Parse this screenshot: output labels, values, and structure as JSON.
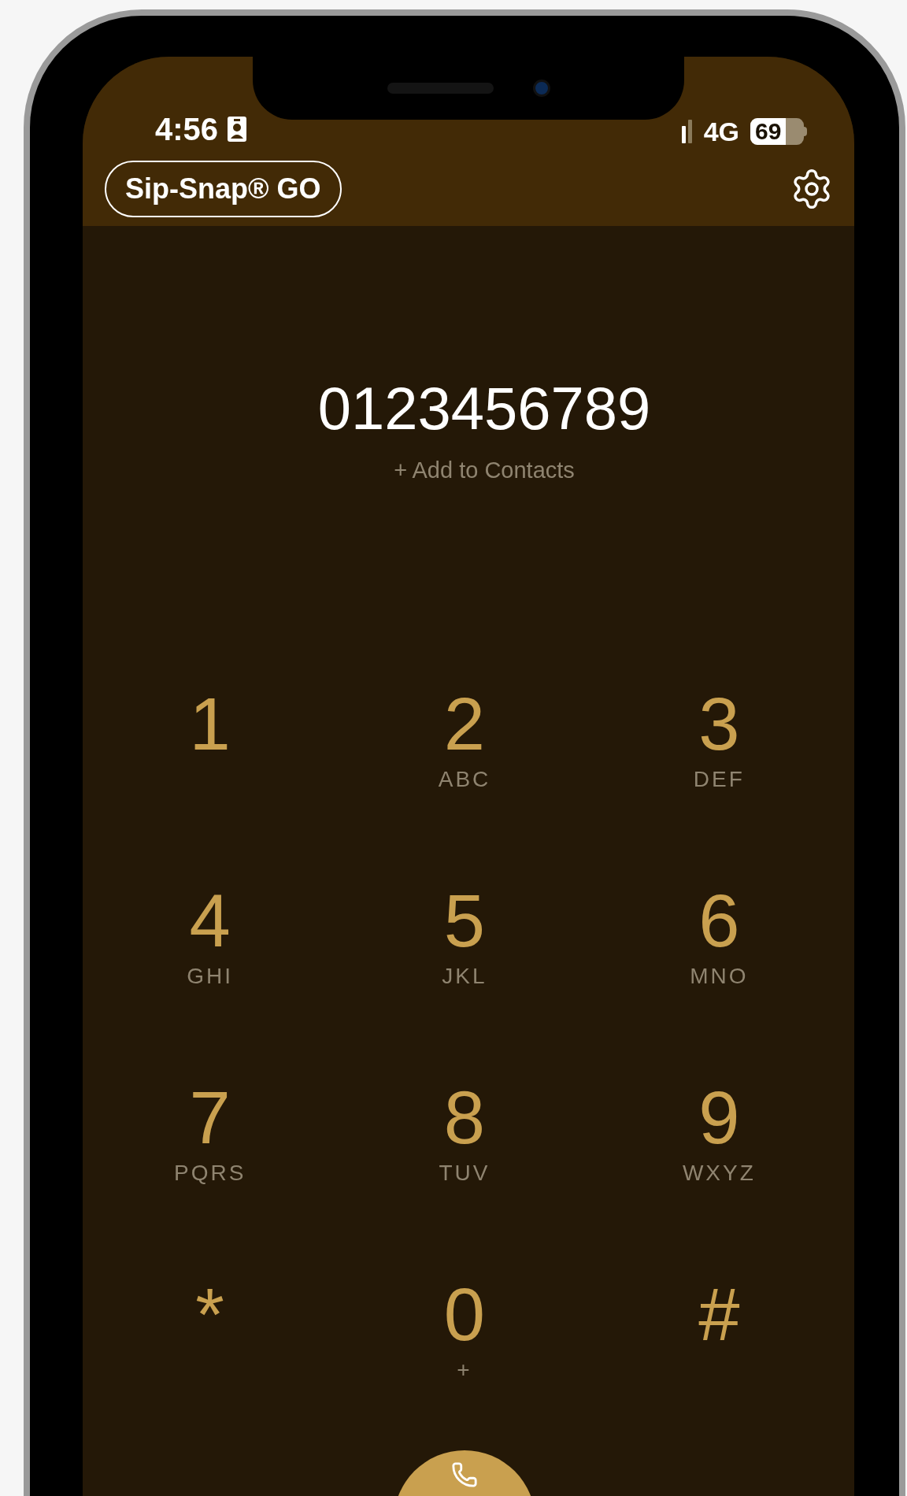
{
  "status_bar": {
    "time": "4:56",
    "network": "4G",
    "battery": "69"
  },
  "header": {
    "app_button": "Sip-Snap® GO"
  },
  "dialer": {
    "number": "0123456789",
    "add_contact": "+ Add to Contacts"
  },
  "keypad": [
    {
      "digit": "1"
    },
    {
      "digit": "2",
      "letters": "ABC"
    },
    {
      "digit": "3",
      "letters": "DEF"
    },
    {
      "digit": "4",
      "letters": "GHI"
    },
    {
      "digit": "5",
      "letters": "JKL"
    },
    {
      "digit": "6",
      "letters": "MNO"
    },
    {
      "digit": "7",
      "letters": "PQRS"
    },
    {
      "digit": "8",
      "letters": "TUV"
    },
    {
      "digit": "9",
      "letters": "WXYZ"
    },
    {
      "digit": "*"
    },
    {
      "digit": "0",
      "letters": "+"
    },
    {
      "digit": "#"
    }
  ]
}
